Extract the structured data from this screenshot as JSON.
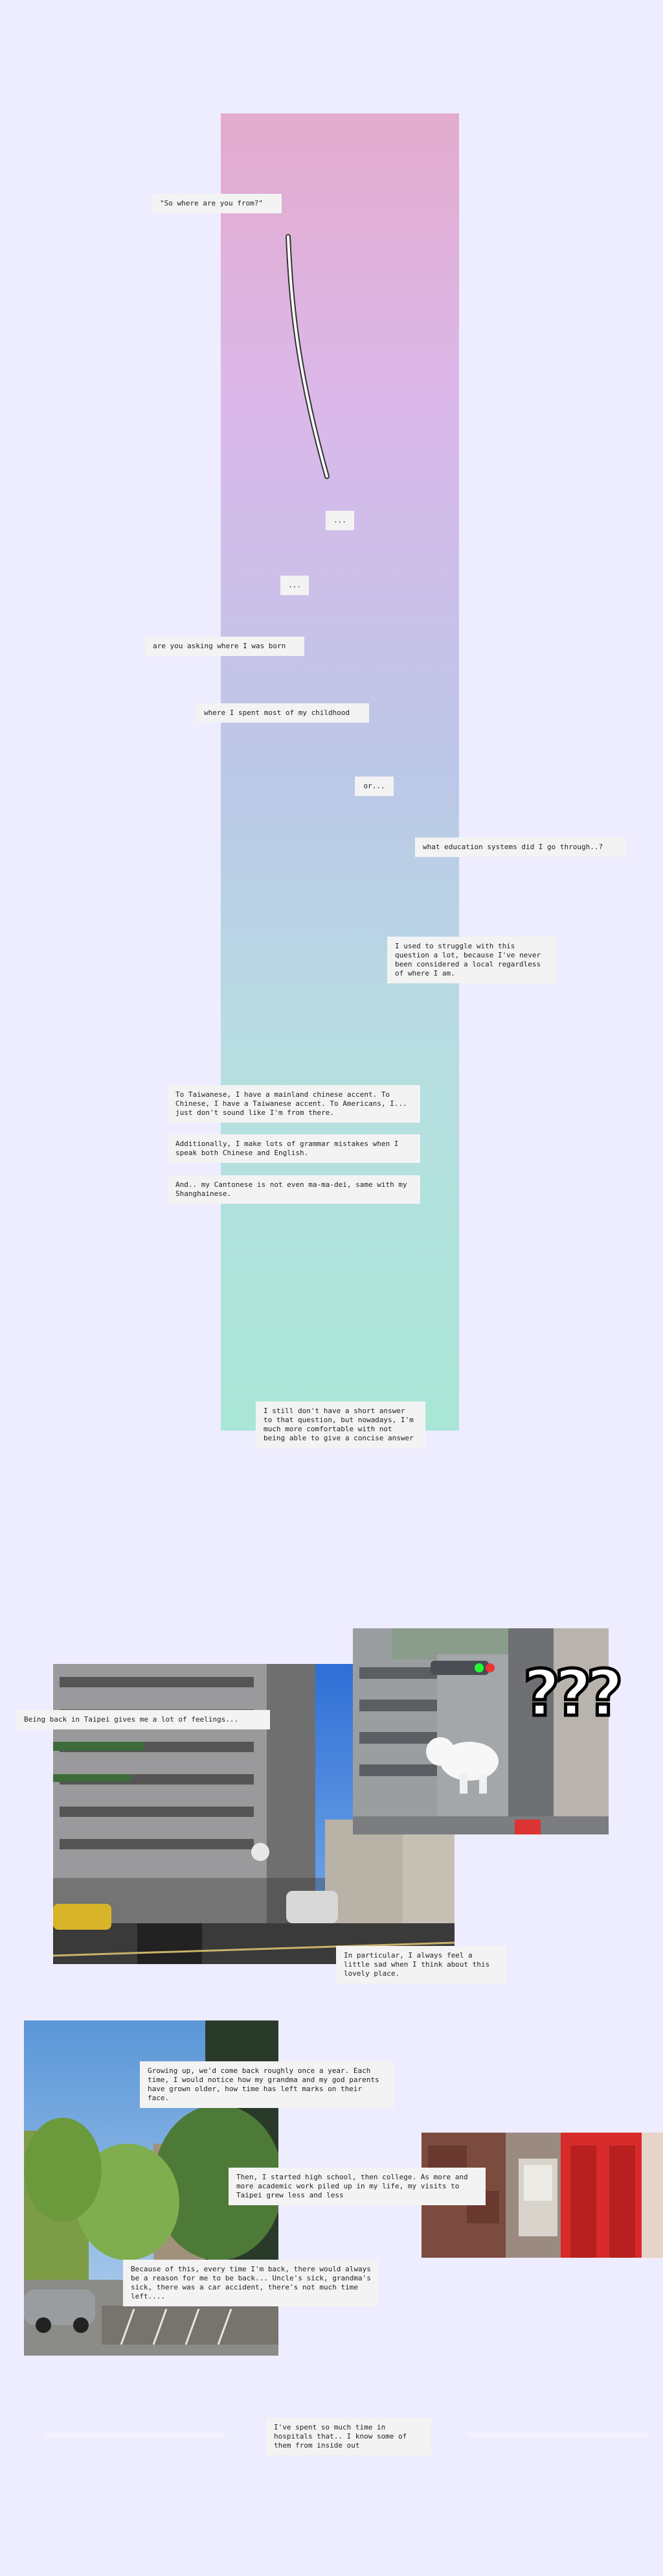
{
  "story": {
    "q1": "\"So where are you from?\"",
    "dots1": "...",
    "dots2": "...",
    "q2": "are you asking where I was born",
    "q3": "where I spent most of my childhood",
    "q4": "or...",
    "q5": "what education systems did I go through..?",
    "p1": "I used to struggle with this question a lot, because I've never been considered a local regardless of where I am.",
    "p2": "To Taiwanese, I have a mainland chinese accent. To Chinese, I have a Taiwanese accent. To Americans, I... just don't sound like I'm from there.",
    "p3": "Additionally, I make lots of grammar mistakes when I speak both Chinese and English.",
    "p4": "And.. my Cantonese is not even ma-ma-dei, same with my Shanghainese.",
    "p5": "I still don't have a short answer to that question, but nowadays, I'm much more comfortable with not being able to give a concise answer"
  },
  "taipei": {
    "intro": "Being back in Taipei gives me a lot of feelings...",
    "question_marks": "???",
    "sad": "In particular, I always feel a little sad when I think about this lovely place."
  },
  "family": {
    "p1": "Growing up, we'd come back roughly once a year. Each time, I would notice how my grandma and my god parents have grown older, how time has left marks on their face.",
    "p2": "Then, I started high school, then college. As more and more academic work piled up in my life, my visits to Taipei grew less and less",
    "p3": "Because of this, every time I'm back, there would always be a reason for me to be back... Uncle's sick, grandma's sick, there was a car accident, there's not much time left....",
    "p4": "I've spent so much time in hospitals that.. I know some of them from inside out"
  },
  "colors": {
    "background": "#eeecff",
    "gradient_top": "#e3abcd",
    "gradient_bottom": "#a9e6d6",
    "bubble": "#f3f3f3"
  }
}
